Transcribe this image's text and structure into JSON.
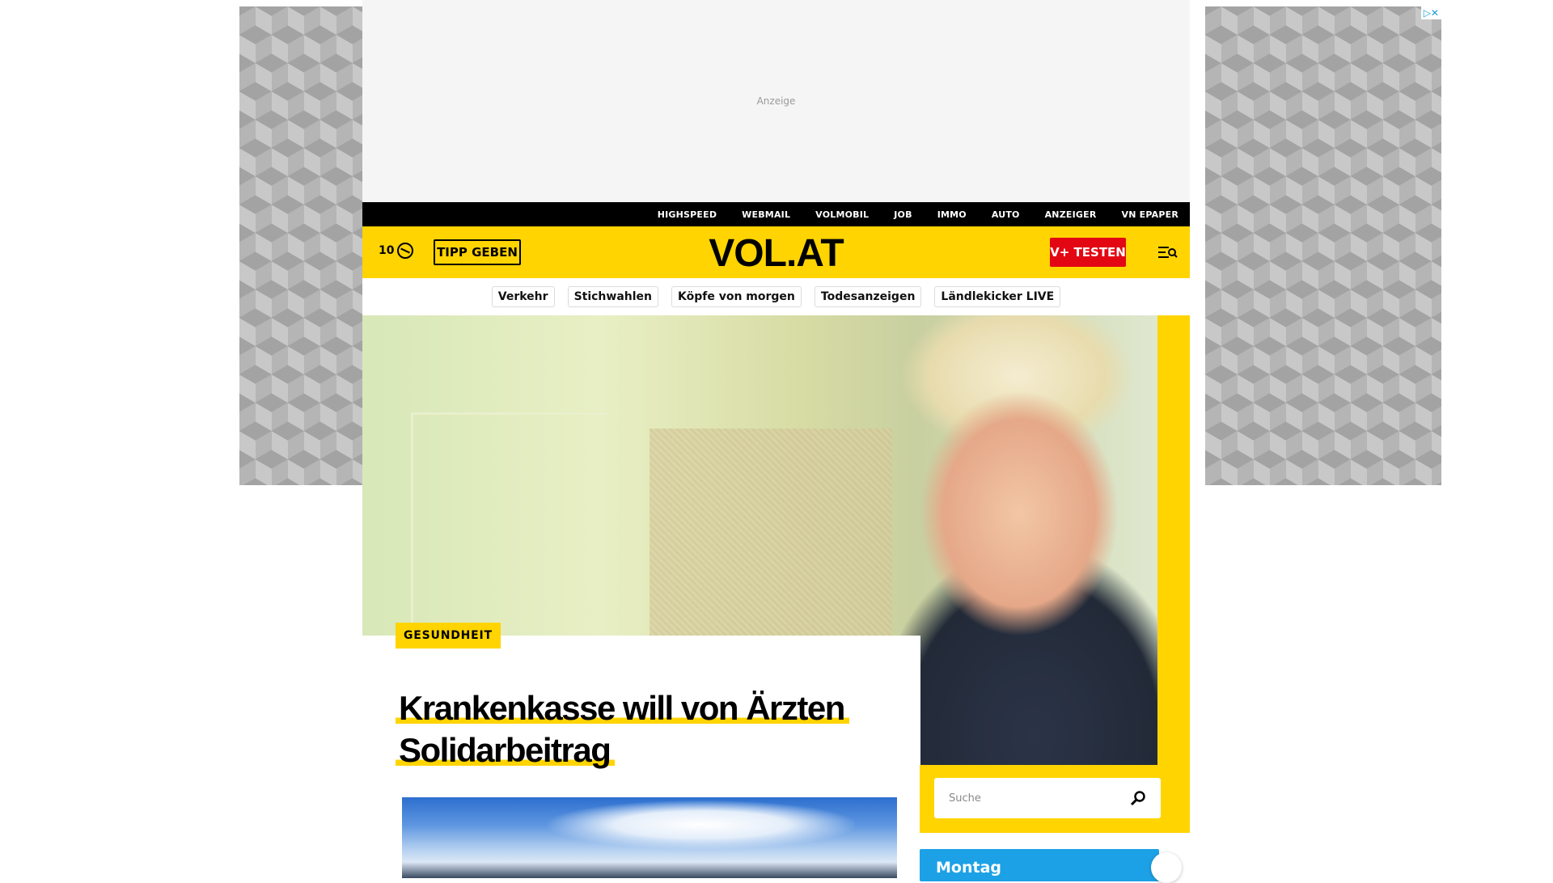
{
  "ads": {
    "top_label": "Anzeige",
    "choices": "▷✕"
  },
  "service_nav": [
    "HIGHSPEED",
    "WEBMAIL",
    "VOLMOBIL",
    "JOB",
    "IMMO",
    "AUTO",
    "ANZEIGER",
    "VN EPAPER"
  ],
  "header": {
    "counter": "10",
    "tipp_label": "TIPP GEBEN",
    "logo": "VOL.AT",
    "vplus_label": "V+ TESTEN"
  },
  "topic_tags": [
    "Verkehr",
    "Stichwahlen",
    "Köpfe von morgen",
    "Todesanzeigen",
    "Ländlekicker LIVE"
  ],
  "hero": {
    "category": "GESUNDHEIT",
    "headline": "Krankenkasse will von Ärzten Solidarbeitrag"
  },
  "search": {
    "placeholder": "Suche"
  },
  "sidebar": {
    "day_label": "Montag"
  },
  "colors": {
    "brand_yellow": "#ffd400",
    "vplus_red": "#e30613",
    "day_blue": "#1ca1e6"
  }
}
